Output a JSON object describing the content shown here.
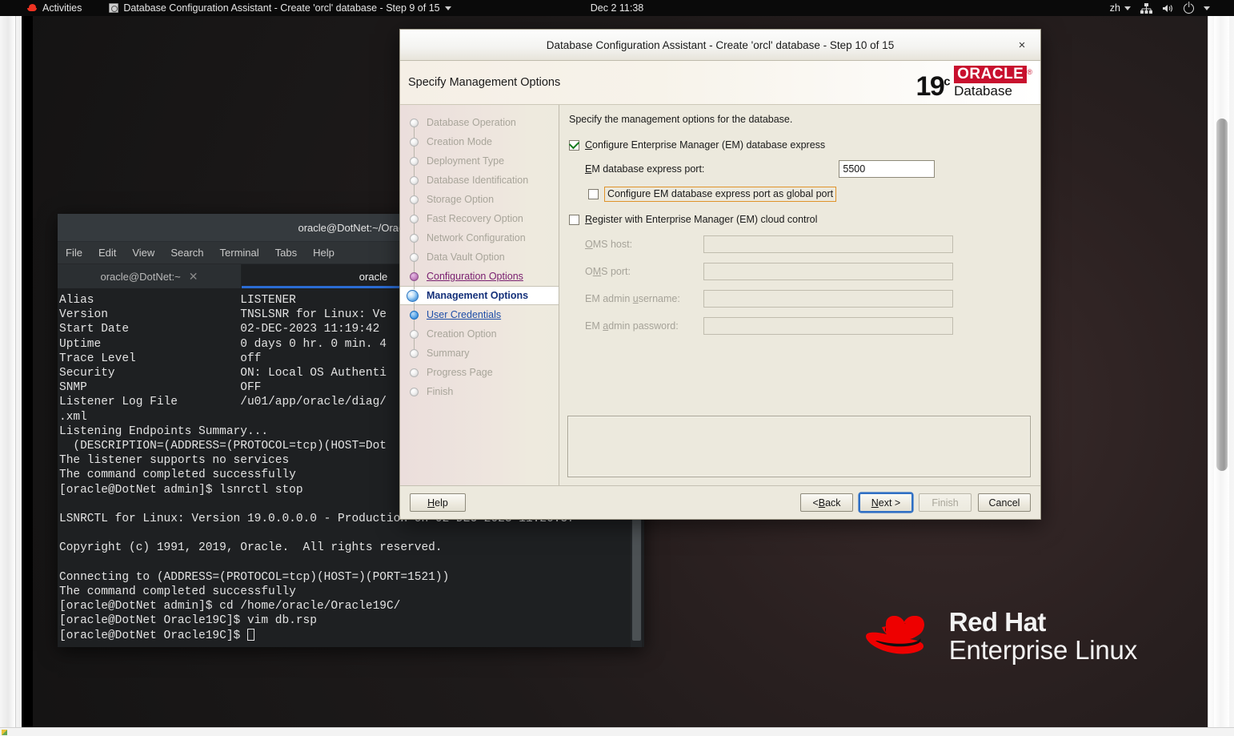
{
  "topbar": {
    "activities": "Activities",
    "app_title": "Database Configuration Assistant - Create 'orcl' database - Step 9 of 15",
    "clock": "Dec 2  11:38",
    "language": "zh",
    "icons": [
      "network-icon",
      "volume-icon",
      "power-icon"
    ]
  },
  "terminal": {
    "title": "oracle@DotNet:~/Orac",
    "menus": [
      "File",
      "Edit",
      "View",
      "Search",
      "Terminal",
      "Tabs",
      "Help"
    ],
    "tabs": [
      {
        "label": "oracle@DotNet:~",
        "active": false
      },
      {
        "label": "oracle",
        "active": true
      }
    ],
    "output": "Alias                     LISTENER\nVersion                   TNSLSNR for Linux: Ve\nStart Date                02-DEC-2023 11:19:42\nUptime                    0 days 0 hr. 0 min. 4\nTrace Level               off\nSecurity                  ON: Local OS Authenti\nSNMP                      OFF\nListener Log File         /u01/app/oracle/diag/\n.xml\nListening Endpoints Summary...\n  (DESCRIPTION=(ADDRESS=(PROTOCOL=tcp)(HOST=Dot\nThe listener supports no services\nThe command completed successfully\n[oracle@DotNet admin]$ lsnrctl stop\n\nLSNRCTL for Linux: Version 19.0.0.0.0 - Production on 02-DEC-2023 11:20:57\n\nCopyright (c) 1991, 2019, Oracle.  All rights reserved.\n\nConnecting to (ADDRESS=(PROTOCOL=tcp)(HOST=)(PORT=1521))\nThe command completed successfully\n[oracle@DotNet admin]$ cd /home/oracle/Oracle19C/\n[oracle@DotNet Oracle19C]$ vim db.rsp\n[oracle@DotNet Oracle19C]$ "
  },
  "watermark": {
    "line1": "Red Hat",
    "line2": "Enterprise Linux"
  },
  "dialog": {
    "title": "Database Configuration Assistant - Create 'orcl' database - Step 10 of 15",
    "close_label": "×",
    "header_title": "Specify Management Options",
    "brand": {
      "version": "19",
      "superscript": "c",
      "name": "ORACLE",
      "registered": "®",
      "product": "Database"
    },
    "intro": "Specify the management options for the database.",
    "steps": [
      {
        "label": "Database Operation",
        "state": "pending"
      },
      {
        "label": "Creation Mode",
        "state": "pending"
      },
      {
        "label": "Deployment Type",
        "state": "pending"
      },
      {
        "label": "Database Identification",
        "state": "pending"
      },
      {
        "label": "Storage Option",
        "state": "pending"
      },
      {
        "label": "Fast Recovery Option",
        "state": "pending"
      },
      {
        "label": "Network Configuration",
        "state": "pending"
      },
      {
        "label": "Data Vault Option",
        "state": "pending"
      },
      {
        "label": "Configuration Options",
        "state": "done"
      },
      {
        "label": "Management Options",
        "state": "current"
      },
      {
        "label": "User Credentials",
        "state": "visited"
      },
      {
        "label": "Creation Option",
        "state": "pending"
      },
      {
        "label": "Summary",
        "state": "pending"
      },
      {
        "label": "Progress Page",
        "state": "pending"
      },
      {
        "label": "Finish",
        "state": "pending"
      }
    ],
    "options": {
      "em_express_checkbox": "Configure Enterprise Manager (EM) database express",
      "em_express_checked": true,
      "em_port_label": "EM database express port:",
      "em_port_value": "5500",
      "global_port_checkbox": "Configure EM database express port as global port",
      "global_port_checked": false,
      "cloud_control_checkbox": "Register with Enterprise Manager (EM) cloud control",
      "cloud_control_checked": false,
      "oms_host_label": "OMS host:",
      "oms_host_value": "",
      "oms_port_label": "OMS port:",
      "oms_port_value": "",
      "em_admin_user_label": "EM admin username:",
      "em_admin_user_value": "",
      "em_admin_pass_label": "EM admin password:",
      "em_admin_pass_value": ""
    },
    "buttons": {
      "help": "Help",
      "back": "< Back",
      "next": "Next >",
      "finish": "Finish",
      "cancel": "Cancel"
    },
    "colors": {
      "accent_focus": "#e0932a",
      "brand_red": "#c8102e",
      "current_step": "#14307a"
    }
  }
}
